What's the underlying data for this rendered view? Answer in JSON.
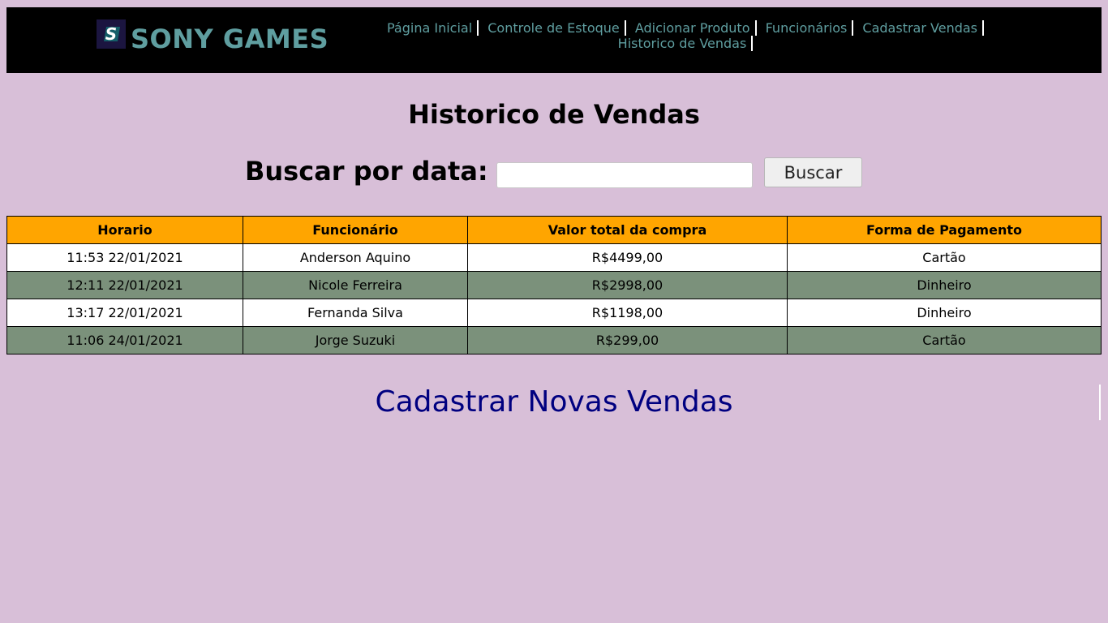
{
  "header": {
    "brand": "SONY GAMES",
    "logo_icon": "sony-games-logo-icon",
    "nav": [
      {
        "label": "Página Inicial"
      },
      {
        "label": "Controle de Estoque"
      },
      {
        "label": "Adicionar Produto"
      },
      {
        "label": "Funcionários"
      },
      {
        "label": "Cadastrar Vendas"
      },
      {
        "label": "Historico de Vendas"
      }
    ]
  },
  "main": {
    "title": "Historico de Vendas",
    "search": {
      "label": "Buscar por data:",
      "value": "",
      "button_label": "Buscar"
    },
    "table": {
      "headers": [
        "Horario",
        "Funcionário",
        "Valor total da compra",
        "Forma de Pagamento"
      ],
      "rows": [
        [
          "11:53 22/01/2021",
          "Anderson Aquino",
          "R$4499,00",
          "Cartão"
        ],
        [
          "12:11 22/01/2021",
          "Nicole Ferreira",
          "R$2998,00",
          "Dinheiro"
        ],
        [
          "13:17 22/01/2021",
          "Fernanda Silva",
          "R$1198,00",
          "Dinheiro"
        ],
        [
          "11:06 24/01/2021",
          "Jorge Suzuki",
          "R$299,00",
          "Cartão"
        ]
      ]
    },
    "new_sales_link": "Cadastrar Novas Vendas"
  },
  "colors": {
    "background": "#d8bfd8",
    "header_bg": "#000000",
    "brand": "#5f9ea0",
    "table_header": "#ffa500",
    "row_alt": "#7b917b",
    "link": "#000080"
  }
}
